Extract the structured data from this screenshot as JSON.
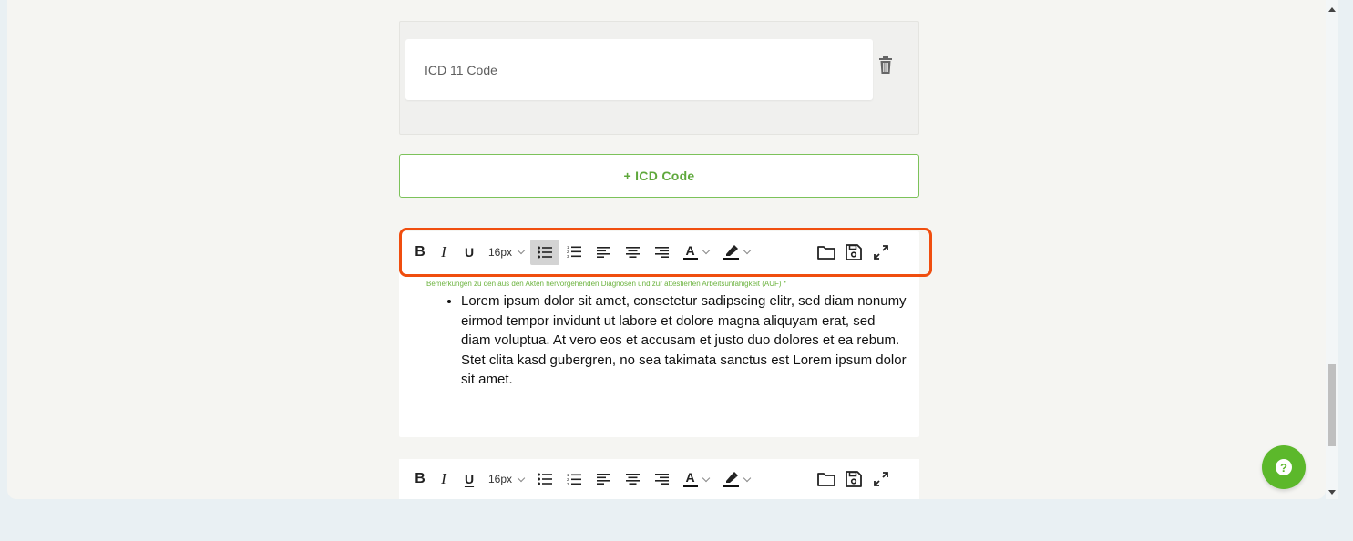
{
  "icd": {
    "input_placeholder": "ICD 11 Code",
    "add_button_label": "+ ICD Code"
  },
  "editor": {
    "font_size": "16px",
    "field_label": "Bemerkungen zu den aus den Akten hervorgehenden Diagnosen und zur attestierten Arbeitsunfähigkeit (AUF) *",
    "bullet_text": "Lorem ipsum dolor sit amet, consetetur sadipscing elitr, sed diam nonumy eirmod tempor invidunt ut labore et dolore magna aliquyam erat, sed diam voluptua. At vero eos et accusam et justo duo dolores et ea rebum. Stet clita kasd gubergren, no sea takimata sanctus est Lorem ipsum dolor sit amet."
  },
  "toolbar_labels": {
    "bold": "B",
    "italic": "I",
    "underline": "U",
    "text_color_letter": "A"
  },
  "help": {
    "label": "?"
  },
  "colors": {
    "accent_green": "#6cb33f",
    "highlight_orange": "#f04e0f",
    "help_green": "#5cb82b"
  },
  "icons": {
    "trash": "trash-icon",
    "bullet_list": "bullet-list-icon",
    "numbered_list": "numbered-list-icon",
    "align_left": "align-left-icon",
    "align_center": "align-center-icon",
    "align_right": "align-right-icon",
    "text_color": "text-color-icon",
    "highlight_color": "highlight-color-icon",
    "folder": "folder-icon",
    "save": "save-icon",
    "fullscreen": "fullscreen-icon",
    "help": "help-icon"
  }
}
